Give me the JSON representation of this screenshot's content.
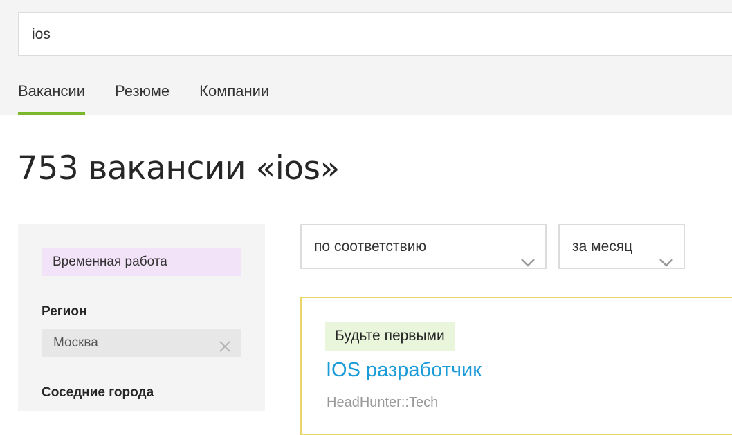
{
  "search": {
    "value": "ios"
  },
  "tabs": [
    {
      "label": "Вакансии",
      "active": true
    },
    {
      "label": "Резюме",
      "active": false
    },
    {
      "label": "Компании",
      "active": false
    }
  ],
  "results": {
    "title": "753 вакансии «ios»"
  },
  "sidebar": {
    "temp_work_chip": "Временная работа",
    "region_label": "Регион",
    "region_value": "Москва",
    "nearby_label": "Соседние города"
  },
  "filters": {
    "sort_value": "по соответствию",
    "period_value": "за месяц"
  },
  "vacancy": {
    "badge": "Будьте первыми",
    "title": "IOS разработчик",
    "subtitle": "HeadHunter::Tech"
  },
  "colors": {
    "accent_green": "#78b82a",
    "link_blue": "#1b9bd8",
    "card_border": "#ead56a",
    "temp_chip_bg": "#f3e3f8",
    "badge_bg": "#eaf6dc"
  }
}
